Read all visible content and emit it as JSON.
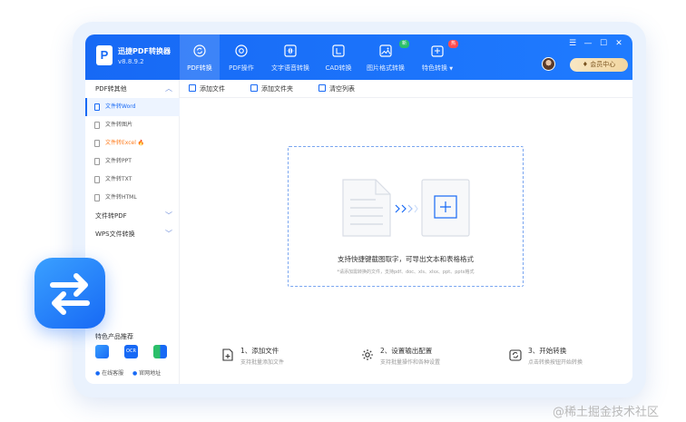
{
  "app": {
    "name": "迅捷PDF转换器",
    "version": "v8.8.9.2"
  },
  "nav": {
    "tabs": [
      {
        "label": "PDF转换",
        "icon": "refresh-circle-icon",
        "active": true
      },
      {
        "label": "PDF操作",
        "icon": "pdf-tools-icon",
        "active": false
      },
      {
        "label": "文字语音转换",
        "icon": "voice-wave-icon",
        "active": false
      },
      {
        "label": "CAD转换",
        "icon": "cad-icon",
        "active": false
      },
      {
        "label": "图片格式转换",
        "icon": "image-icon",
        "active": false,
        "badge": "新"
      },
      {
        "label": "特色转换",
        "icon": "feature-icon",
        "active": false,
        "badge": "热",
        "dropdown": true
      }
    ],
    "dropdown_arrow": "▼"
  },
  "window_controls": {
    "menu": "☰",
    "minimize": "—",
    "maximize": "☐",
    "close": "✕"
  },
  "member_center": "会员中心",
  "sidebar": {
    "groups": [
      {
        "label": "PDF转其他",
        "expanded": true,
        "items": [
          {
            "label": "文件转Word",
            "active": true
          },
          {
            "label": "文件转图片",
            "active": false
          },
          {
            "label": "文件转Excel",
            "active": false,
            "hot": true
          },
          {
            "label": "文件转PPT",
            "active": false
          },
          {
            "label": "文件转TXT",
            "active": false
          },
          {
            "label": "文件转HTML",
            "active": false
          }
        ]
      },
      {
        "label": "文件转PDF",
        "expanded": false
      },
      {
        "label": "WPS文件转换",
        "expanded": false
      }
    ],
    "chevron_up": "︿",
    "chevron_down": "﹀",
    "hot_mark": "🔥",
    "recommend_label": "特色产品推荐",
    "products": [
      "product-pdf-editor-icon",
      "product-ocr-icon",
      "product-compress-icon"
    ],
    "ocr_text": "OCR",
    "footer": {
      "service": "在线客服",
      "website": "官网地址"
    }
  },
  "toolbar": {
    "add_file": "添加文件",
    "add_folder": "添加文件夹",
    "clear_list": "清空列表"
  },
  "dropzone": {
    "title": "支持快捷键截图取字，可导出文本和表格格式",
    "hint": "*请添加需转换的文件，支持pdf、doc、xls、xlsx、ppt、pptx格式"
  },
  "steps": [
    {
      "title": "1、添加文件",
      "desc": "支持批量添加文件",
      "icon": "add-file-icon"
    },
    {
      "title": "2、设置输出配置",
      "desc": "支持批量操作和各种设置",
      "icon": "settings-gear-icon"
    },
    {
      "title": "3、开始转换",
      "desc": "点击转换按钮开始转换",
      "icon": "start-convert-icon"
    }
  ],
  "watermark": "@稀土掘金技术社区",
  "colors": {
    "primary": "#1769f5",
    "badge_new": "#2bbf6a",
    "badge_hot": "#ff4d4f",
    "member_gold": "#f2d6a0"
  }
}
